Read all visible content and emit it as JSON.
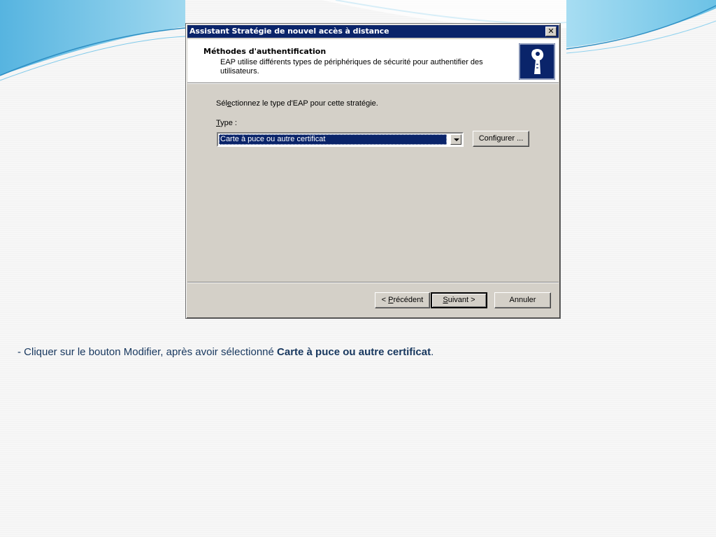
{
  "dialog": {
    "title": "Assistant Stratégie de nouvel accès à distance",
    "close_glyph": "✕",
    "header_title": "Méthodes d'authentification",
    "header_desc": "EAP utilise différents types de périphériques de sécurité pour authentifier des utilisateurs.",
    "prompt": {
      "pre": "Sél",
      "accel": "e",
      "post": "ctionnez le type d'EAP pour cette stratégie."
    },
    "type_label": {
      "accel": "T",
      "post": "ype :"
    },
    "type_value": "Carte à puce ou autre certificat",
    "configure_button": {
      "pre": "Confi",
      "accel": "g",
      "post": "urer ..."
    },
    "back_button": {
      "pre": "< ",
      "accel": "P",
      "post": "récédent"
    },
    "next_button": {
      "accel": "S",
      "post": "uivant >"
    },
    "cancel_button": "Annuler"
  },
  "caption": {
    "text": "- Cliquer sur le bouton Modifier, après avoir sélectionné ",
    "bold": "Carte à puce ou autre certificat",
    "suffix": "."
  },
  "colors": {
    "titlebar": "#0a246a",
    "dialog_face": "#d4d0c8",
    "caption_text": "#17375e",
    "deco_blue": "#5bb9e0"
  }
}
